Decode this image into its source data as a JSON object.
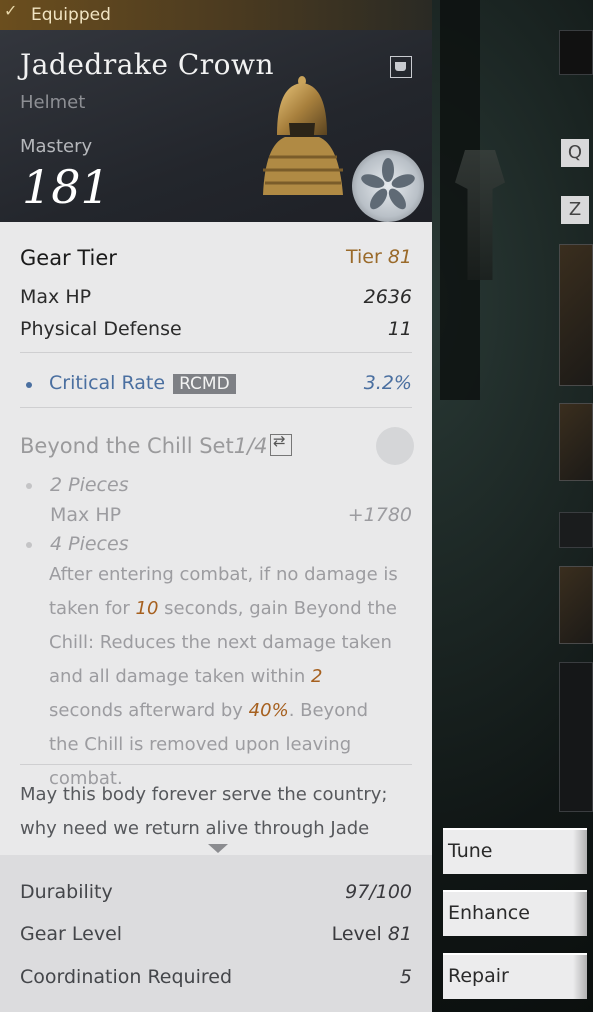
{
  "equipped_label": "Equipped",
  "item": {
    "name": "Jadedrake Crown",
    "type": "Helmet",
    "mastery_label": "Mastery",
    "mastery_value": "181"
  },
  "stats": {
    "gear_tier_label": "Gear Tier",
    "gear_tier_prefix": "Tier",
    "gear_tier_value": "81",
    "max_hp_label": "Max HP",
    "max_hp_value": "2636",
    "phys_def_label": "Physical Defense",
    "phys_def_value": "11",
    "crit_label": "Critical Rate",
    "crit_badge": "RCMD",
    "crit_value": "3.2%"
  },
  "set_bonus": {
    "title": "Beyond the Chill Set",
    "count": "1/4",
    "piece2_label": "2 Pieces",
    "piece2_stat": "Max HP",
    "piece2_value": "+1780",
    "piece4_label": "4 Pieces",
    "desc_1": "After entering combat, if no damage is taken for ",
    "desc_num1": "10",
    "desc_2": " seconds, gain Beyond the Chill: Reduces the next damage taken and all damage taken within ",
    "desc_num2": "2",
    "desc_3": " seconds afterward by ",
    "desc_num3": "40%",
    "desc_4": ". Beyond the Chill is removed upon leaving combat."
  },
  "lore": "May this body forever serve the country; why need we return alive through Jade",
  "footer": {
    "durability_label": "Durability",
    "durability_value": "97/100",
    "gear_level_label": "Gear Level",
    "gear_level_prefix": "Level",
    "gear_level_value": "81",
    "coord_label": "Coordination Required",
    "coord_value": "5"
  },
  "hotkeys": [
    "Q",
    "Z"
  ],
  "actions": [
    "Tune",
    "Enhance",
    "Repair"
  ],
  "colors": {
    "tier_accent": "#9a6a2a",
    "stat_blue": "#4a6fa0",
    "set_highlight": "#a6601f"
  }
}
